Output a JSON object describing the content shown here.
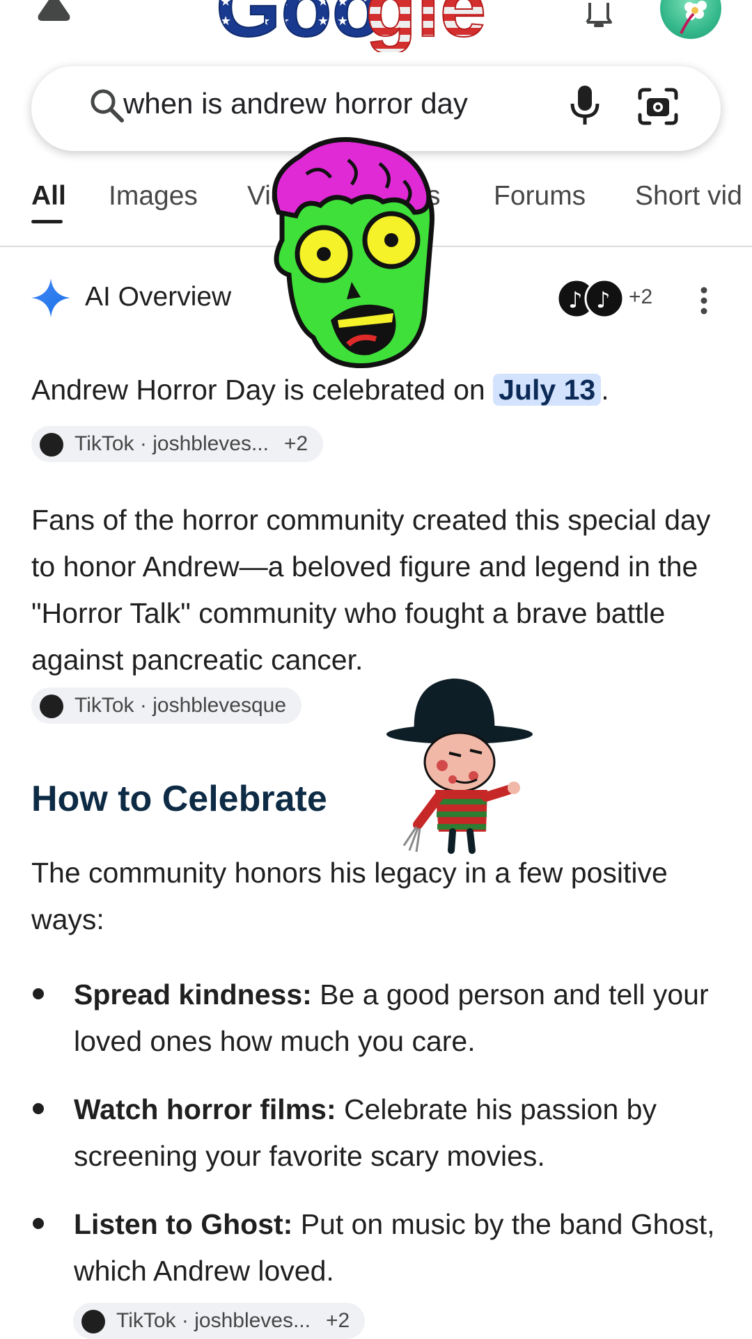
{
  "logo": {
    "text": "Google"
  },
  "search": {
    "query": "when is andrew horror day"
  },
  "tabs": [
    {
      "label": "All",
      "active": true
    },
    {
      "label": "Images",
      "active": false
    },
    {
      "label": "Videos",
      "active": false
    },
    {
      "label": "News",
      "active": false
    },
    {
      "label": "Forums",
      "active": false
    },
    {
      "label": "Short vid",
      "active": false
    }
  ],
  "ai_overview": {
    "title": "AI Overview",
    "source_count": "+2"
  },
  "answer": {
    "text_before": "Andrew Horror Day is celebrated on ",
    "highlight": "July 13",
    "text_after": "."
  },
  "chips": [
    {
      "label": "TikTok · joshbleves...",
      "count": "+2"
    },
    {
      "label": "TikTok · joshblevesque",
      "count": ""
    },
    {
      "label": "TikTok · joshbleves...",
      "count": "+2"
    }
  ],
  "paragraph1": "Fans of the horror community created this special day to honor Andrew—a beloved figure and legend in the \"Horror Talk\" community who fought a brave battle against pancreatic cancer.",
  "heading": "How to Celebrate",
  "paragraph2": "The community honors his legacy in a few positive ways:",
  "bullets": [
    {
      "bold": "Spread kindness:",
      "text": " Be a good person and tell your loved ones how much you care."
    },
    {
      "bold": "Watch horror films:",
      "text": " Celebrate his passion by screening your favorite scary movies."
    },
    {
      "bold": "Listen to Ghost:",
      "text": " Put on music by the band Ghost, which Andrew loved."
    }
  ],
  "colors": {
    "highlight_bg": "#d3e3fd",
    "heading": "#0d2b45",
    "accent_blue": "#4285f4"
  }
}
